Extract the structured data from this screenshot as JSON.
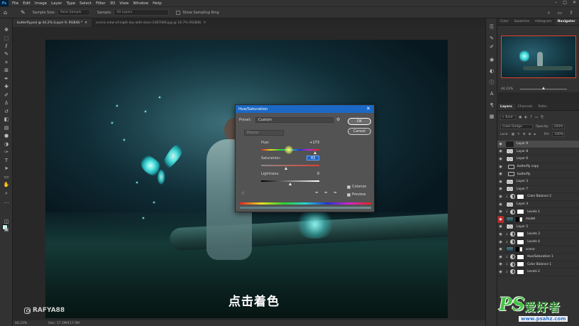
{
  "app": {
    "logo": "Ps",
    "menus": [
      "File",
      "Edit",
      "Image",
      "Layer",
      "Type",
      "Select",
      "Filter",
      "3D",
      "View",
      "Window",
      "Help"
    ]
  },
  "options_bar": {
    "sample_size_label": "Sample Size:",
    "sample_size_value": "Point Sample",
    "sample_label": "Sample:",
    "sample_value": "All Layers",
    "show_ring_label": "Show Sampling Ring"
  },
  "tabs": [
    {
      "label": "butterfly.psd @ 44.2% (Layer 9, RGB/8) *",
      "active": true
    },
    {
      "label": "scenic-view-of-night-sky-with-stars-1487009.jpg @ 16.7% (RGB/8)",
      "active": false
    }
  ],
  "canvas": {
    "subtitle": "点击着色",
    "handle": "RAFYA88"
  },
  "status_bar": {
    "zoom": "44.23%",
    "doc": "Doc: 17.1M/117.5M"
  },
  "dialog": {
    "title": "Hue/Saturation",
    "preset_label": "Preset:",
    "preset_value": "Custom",
    "channel_value": "Master",
    "hue_label": "Hue:",
    "hue_value": "+173",
    "saturation_label": "Saturation:",
    "saturation_value": "43",
    "lightness_label": "Lightness:",
    "lightness_value": "0",
    "ok_label": "OK",
    "cancel_label": "Cancel",
    "colorize_label": "Colorize",
    "preview_label": "Preview",
    "colorize_checked": true,
    "preview_checked": true,
    "hue_slider_fraction": 0.93,
    "saturation_slider_fraction": 0.43,
    "lightness_slider_fraction": 0.5
  },
  "right_panels": {
    "top_tabs": [
      "Color",
      "Swatches",
      "Histogram",
      "Navigator"
    ],
    "nav_zoom": "44.23%",
    "layer_tabs": [
      "Layers",
      "Channels",
      "Paths"
    ],
    "kind_label": "Kind",
    "blend_mode": "Color Dodge",
    "opacity_label": "Opacity:",
    "opacity_value": "100%",
    "lock_label": "Lock:",
    "fill_label": "Fill:",
    "fill_value": "100%",
    "layers": [
      {
        "name": "Layer 9",
        "thumb": "dark",
        "selected": true,
        "eye": "visible"
      },
      {
        "name": "Layer 8",
        "thumb": "checker",
        "eye": "visible"
      },
      {
        "name": "Layer 6",
        "thumb": "checker",
        "eye": "visible"
      },
      {
        "name": "butterfly copy",
        "thumb": "folder",
        "eye": "visible"
      },
      {
        "name": "butterfly",
        "thumb": "folder",
        "eye": "visible"
      },
      {
        "name": "Layer 3",
        "thumb": "checker",
        "eye": "visible"
      },
      {
        "name": "Layer 7",
        "thumb": "checker",
        "eye": "visible"
      },
      {
        "name": "Color Balance 2",
        "thumb": "adjust",
        "eye": "visible"
      },
      {
        "name": "Layer 4",
        "thumb": "checker",
        "eye": "visible"
      },
      {
        "name": "Levels 1",
        "thumb": "adjust",
        "eye": "visible"
      },
      {
        "name": "model",
        "thumb": "img",
        "eye": "red"
      },
      {
        "name": "Layer 2",
        "thumb": "checker",
        "eye": "visible"
      },
      {
        "name": "Levels 3",
        "thumb": "adjust",
        "eye": "visible"
      },
      {
        "name": "Levels 4",
        "thumb": "adjust",
        "eye": "visible"
      },
      {
        "name": "scene",
        "thumb": "img",
        "eye": "visible"
      },
      {
        "name": "Hue/Saturation 1",
        "thumb": "adjust",
        "eye": "visible"
      },
      {
        "name": "Color Balance 1",
        "thumb": "adjust",
        "eye": "visible"
      },
      {
        "name": "Levels 2",
        "thumb": "adjust",
        "eye": "visible"
      }
    ]
  },
  "site_watermark": {
    "ps": "PS",
    "cn": "爱好者",
    "url": "www.psahz.com"
  },
  "colors": {
    "accent": "#1b68c5",
    "selected_layer": "#4b4b4b",
    "foreground_swatch": "#c0f3ef"
  }
}
